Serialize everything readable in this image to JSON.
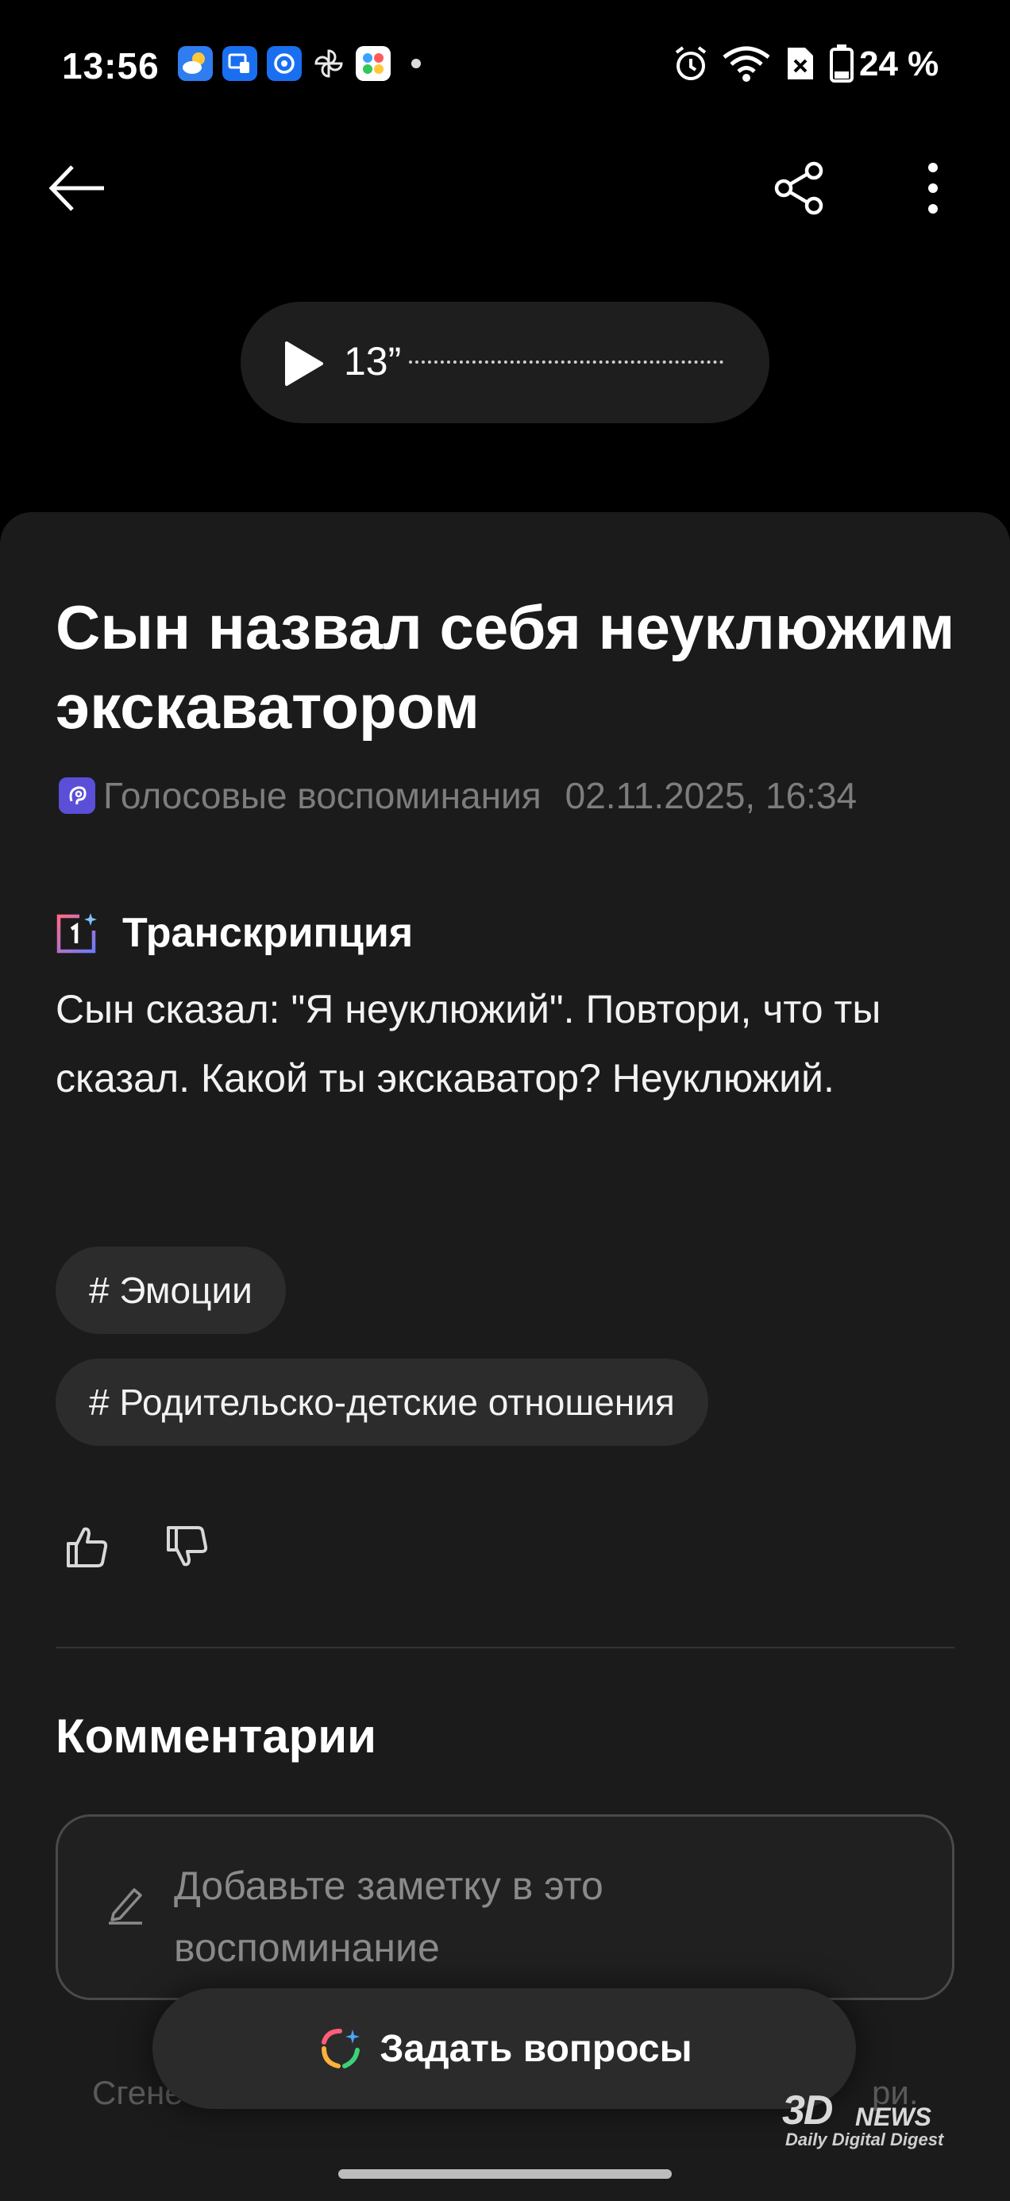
{
  "status_bar": {
    "time": "13:56",
    "battery": "24 %",
    "notification_icons": [
      "weather-icon",
      "screen-mirror-icon",
      "email-icon",
      "pinwheel-icon",
      "apps-icon"
    ]
  },
  "player": {
    "duration": "13”"
  },
  "memory": {
    "title": "Сын назвал себя неуклюжим экскаватором",
    "category": "Голосовые воспоминания",
    "date": "02.11.2025, 16:34"
  },
  "transcription": {
    "heading": "Транскрипция",
    "text": "Сын сказал: \"Я неуклюжий\". Повтори, что ты сказал. Какой ты экскаватор? Неуклюжий."
  },
  "tags": [
    "# Эмоции",
    "# Родительско-детские отношения"
  ],
  "comments": {
    "heading": "Комментарии",
    "placeholder": "Добавьте заметку в это воспоминание"
  },
  "footer": {
    "left_text": "Сгене",
    "right_text": "ри."
  },
  "ask_button": {
    "label": "Задать вопросы"
  },
  "watermark": {
    "brand": "3D",
    "news": "NEWS",
    "tagline": "Daily Digital Digest"
  },
  "colors": {
    "background": "#000000",
    "sheet": "#1b1b1b",
    "chip": "#2c2c2c",
    "muted_text": "#7d7d7d",
    "category_icon": "#5a4fd6"
  }
}
